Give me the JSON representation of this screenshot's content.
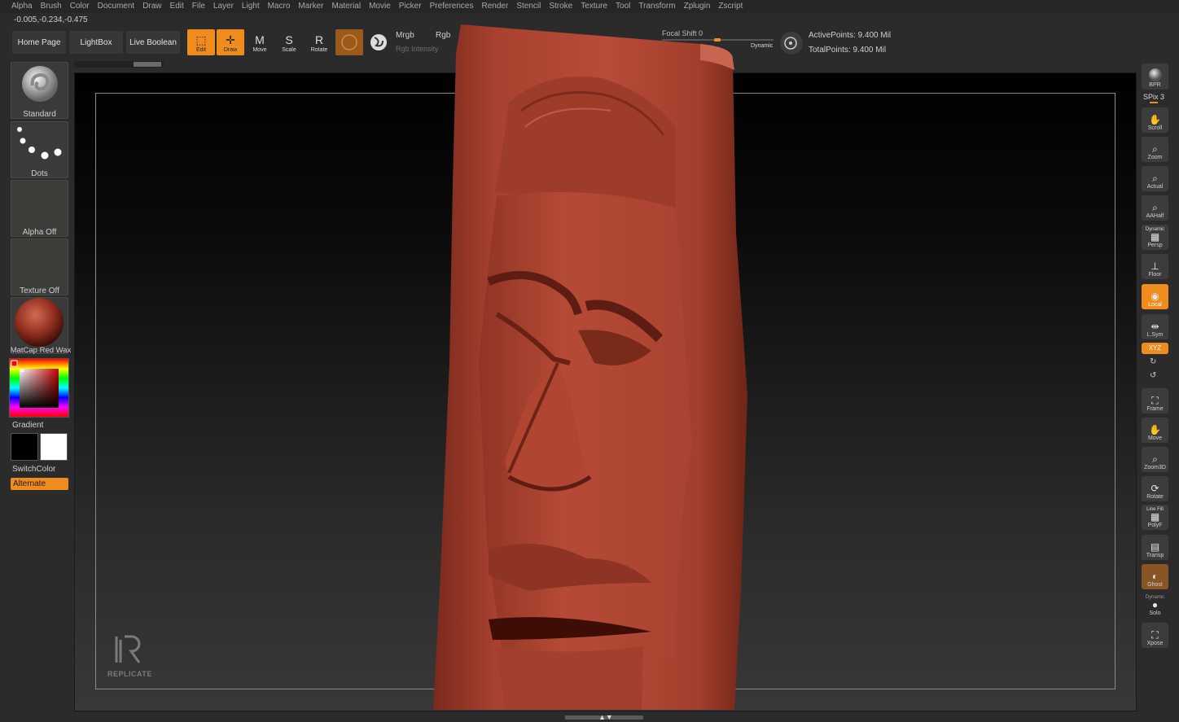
{
  "menu": [
    "Alpha",
    "Brush",
    "Color",
    "Document",
    "Draw",
    "Edit",
    "File",
    "Layer",
    "Light",
    "Macro",
    "Marker",
    "Material",
    "Movie",
    "Picker",
    "Preferences",
    "Render",
    "Stencil",
    "Stroke",
    "Texture",
    "Tool",
    "Transform",
    "Zplugin",
    "Zscript"
  ],
  "coords": "-0.005,-0.234,-0.475",
  "shelf": {
    "home": "Home Page",
    "lightbox": "LightBox",
    "live_boolean": "Live Boolean"
  },
  "tools": [
    {
      "label": "Edit",
      "active": true,
      "icon": "edit-icon"
    },
    {
      "label": "Draw",
      "active": true,
      "icon": "draw-icon"
    },
    {
      "label": "Move",
      "active": false,
      "icon": "move-icon"
    },
    {
      "label": "Scale",
      "active": false,
      "icon": "scale-icon"
    },
    {
      "label": "Rotate",
      "active": false,
      "icon": "rotate-icon"
    }
  ],
  "color_mode": {
    "mrgb": "Mrgb",
    "rgb": "Rgb",
    "rgb_intensity": "Rgb Intensity"
  },
  "focal": {
    "label": "Focal Shift 0",
    "dynamic": "Dynamic"
  },
  "points": {
    "active": "ActivePoints: 9.400 Mil",
    "total": "TotalPoints: 9.400 Mil"
  },
  "left_panel": {
    "brush": "Standard",
    "stroke": "Dots",
    "alpha": "Alpha Off",
    "texture": "Texture Off",
    "material": "MatCap Red Wax",
    "gradient": "Gradient",
    "switch_color": "SwitchColor",
    "alternate": "Alternate"
  },
  "watermark": "REPLICATE",
  "right_shelf": {
    "bpr": "BPR",
    "spix": "SPix 3",
    "scroll": "Scroll",
    "zoom": "Zoom",
    "actual": "Actual",
    "aahalf": "AAHalf",
    "dynamic_persp": "Dynamic",
    "persp": "Persp",
    "floor": "Floor",
    "local": "Local",
    "lsym": "L.Sym",
    "xyz": "XYZ",
    "frame": "Frame",
    "move": "Move",
    "zoom3d": "Zoom3D",
    "rotate": "Rotate",
    "linefill": "Line Fill",
    "polyf": "PolyF",
    "transp": "Transp",
    "ghost": "Ghost",
    "dynamic_solo": "Dynamic",
    "solo": "Solo",
    "xpose": "Xpose"
  },
  "colors": {
    "accent": "#f08b1d",
    "wax": "#a8412f",
    "panel": "#2b2b2b"
  }
}
